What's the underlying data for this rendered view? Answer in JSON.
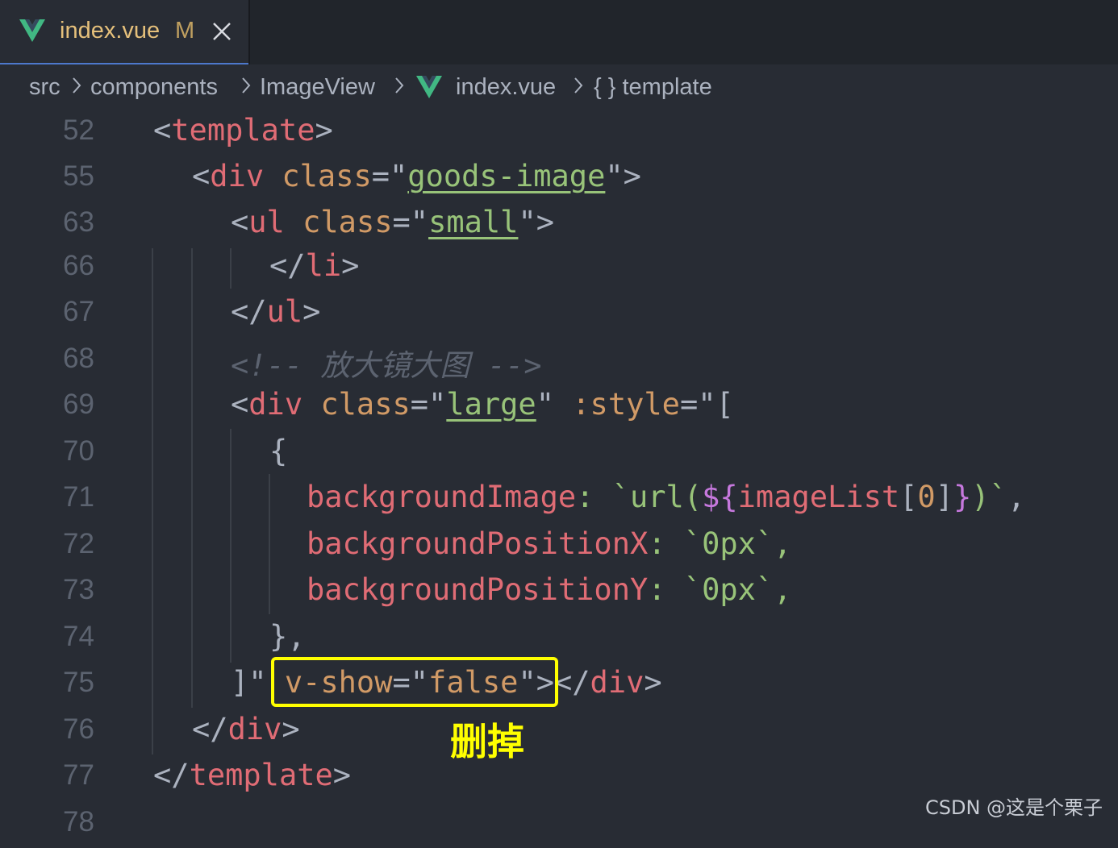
{
  "tab": {
    "title": "index.vue",
    "status": "M"
  },
  "breadcrumb": {
    "items": [
      "src",
      "components",
      "ImageView",
      "index.vue",
      "{ } template"
    ]
  },
  "code_lines": [
    {
      "num": "52",
      "segments": [
        "<",
        "template",
        ">"
      ]
    },
    {
      "num": "55",
      "segments": [
        "<",
        "div",
        " class",
        "=\"",
        "goods-image",
        "\">"
      ]
    },
    {
      "num": "63",
      "segments": [
        "<",
        "ul",
        " class",
        "=\"",
        "small",
        "\">"
      ]
    },
    {
      "num": "66",
      "segments": [
        "</",
        "li",
        ">"
      ]
    },
    {
      "num": "67",
      "segments": [
        "</",
        "ul",
        ">"
      ]
    },
    {
      "num": "68",
      "text": "<!-- 放大镜大图 -->"
    },
    {
      "num": "69",
      "segments": [
        "<",
        "div",
        " class",
        "=\"",
        "large",
        "\"",
        " :style",
        "=\"["
      ]
    },
    {
      "num": "70",
      "text": "{"
    },
    {
      "num": "71",
      "segments": [
        "backgroundImage",
        ": `url(",
        "${",
        "imageList",
        "[",
        "0",
        "]",
        "}",
        ")`",
        ","
      ]
    },
    {
      "num": "72",
      "segments": [
        "backgroundPositionX",
        ": `",
        "0px",
        "`,"
      ]
    },
    {
      "num": "73",
      "segments": [
        "backgroundPositionY",
        ": `",
        "0px",
        "`,"
      ]
    },
    {
      "num": "74",
      "text": "},"
    },
    {
      "num": "75",
      "segments": [
        "]\" ",
        "v-show",
        "=\"",
        "false",
        "\"",
        "></",
        "div",
        ">"
      ]
    },
    {
      "num": "76",
      "segments": [
        "</",
        "div",
        ">"
      ]
    },
    {
      "num": "77",
      "segments": [
        "</",
        "template",
        ">"
      ]
    },
    {
      "num": "78",
      "text": ""
    }
  ],
  "annotation": "删掉",
  "watermark": "CSDN @这是个栗子",
  "colors": {
    "highlight": "#ffff00",
    "tag": "#e06c75",
    "attr": "#d19a66",
    "string": "#98c379",
    "comment": "#5c6370",
    "vue_green": "#41b883"
  },
  "icons": [
    "vue-icon",
    "close-icon",
    "chevron-right-icon"
  ]
}
